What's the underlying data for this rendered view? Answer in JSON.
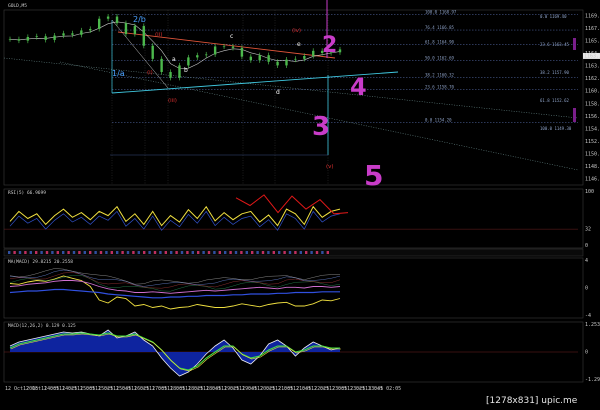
{
  "title": "GOLD,M5",
  "watermark": "[1278x831] upic.me",
  "colors": {
    "background": "#000000",
    "price": "#4cb84c",
    "ma": "#f5f5f5",
    "resistance": "#e0553a",
    "support": "#40c8e0",
    "fib": "#5a6fb0",
    "magenta": "#c83cc8",
    "rsi": "#f0e040",
    "red": "#e01818"
  },
  "chart_data": [
    {
      "type": "line",
      "name": "price",
      "x": [
        "12 Oct 2015",
        "12 Oct 14:05",
        "12 Oct 14:25",
        "12 Oct 14:45",
        "12 Oct 15:05",
        "12 Oct 15:25",
        "12 Oct 15:45",
        "12 Oct 16:05",
        "12 Oct 16:25",
        "12 Oct 16:45",
        "12 Oct 17:05",
        "12 Oct 17:25",
        "12 Oct 17:45",
        "12 Oct 18:05",
        "12 Oct 18:25",
        "12 Oct 18:45",
        "12 Oct 19:05",
        "12 Oct 19:25",
        "12 Oct 19:45",
        "12 Oct 20:05",
        "12 Oct 20:25",
        "12 Oct 20:45",
        "12 Oct 21:05",
        "12 Oct 21:25",
        "12 Oct 21:45",
        "12 Oct 22:05",
        "12 Oct 22:25",
        "12 Oct 22:45",
        "12 Oct 23:05",
        "12 Oct 23:25",
        "12 Oct 23:45",
        "13 Oct 00:05",
        "13 Oct 00:25",
        "13 Oct 00:45",
        "13 Oct 01:05",
        "13 Oct 01:25",
        "13 Oct 01:45",
        "13 Oct 02:05"
      ],
      "values": [
        1165.6,
        1165.4,
        1165.9,
        1166.0,
        1165.5,
        1166.1,
        1166.4,
        1166.2,
        1166.8,
        1167.0,
        1168.4,
        1168.7,
        1167.8,
        1166.3,
        1167.4,
        1164.7,
        1162.9,
        1161.1,
        1160.3,
        1162.0,
        1163.1,
        1163.4,
        1163.5,
        1164.6,
        1164.6,
        1164.4,
        1163.2,
        1162.7,
        1163.4,
        1162.5,
        1162.0,
        1162.8,
        1162.9,
        1163.3,
        1164.0,
        1163.7,
        1163.8,
        1164.2
      ],
      "ylim": [
        1145.6,
        1169.6
      ],
      "yticks": [
        "1169.60",
        "1167.65",
        "1165.65",
        "1164.25",
        "1163.25",
        "1162.10",
        "1160.25",
        "1158.35",
        "1156.45",
        "1154.40",
        "1152.45",
        "1150.50",
        "1148.55",
        "1146.65"
      ],
      "xticks": [
        "12 Oct 2015",
        "12 Oct 14:05",
        "12 Oct 14:25",
        "12 Oct 15:05",
        "12 Oct 15:25",
        "12 Oct 15:45",
        "12 Oct 16:25",
        "12 Oct 17:05",
        "12 Oct 18:05",
        "12 Oct 18:25",
        "12 Oct 18:45",
        "12 Oct 19:25",
        "12 Oct 19:45",
        "12 Oct 20:25",
        "12 Oct 21:05",
        "12 Oct 21:45",
        "12 Oct 22:25",
        "12 Oct 23:05",
        "12 Oct 23:25",
        "12 Oct 23:45",
        "13 Oct 02:05"
      ],
      "current_price": "1163.30",
      "fib_levels": [
        {
          "label": "100.0 1168.97",
          "y": 1168.97
        },
        {
          "label": "76.4 1166.85",
          "y": 1166.85
        },
        {
          "label": "61.8 1164.90",
          "y": 1164.9
        },
        {
          "label": "50.0 1162.69",
          "y": 1162.69
        },
        {
          "label": "38.2 1160.32",
          "y": 1160.32
        },
        {
          "label": "23.6 1158.70",
          "y": 1158.7
        },
        {
          "label": "0.0 1154.20",
          "y": 1154.2
        }
      ],
      "fib_right": [
        "0.0 1169.40",
        "23.6 1163.45",
        "38.2 1157.90",
        "61.8 1152.62",
        "100.0 1149.30"
      ],
      "wave_labels": [
        {
          "text": "2/b",
          "color": "#4aa0ff"
        },
        {
          "text": "(ii)",
          "color": "#e03030"
        },
        {
          "text": "(i)",
          "color": "#e03030"
        },
        {
          "text": "a",
          "color": "#ffffff"
        },
        {
          "text": "(iii)",
          "color": "#e03030"
        },
        {
          "text": "b",
          "color": "#ffffff"
        },
        {
          "text": "c",
          "color": "#ffffff"
        },
        {
          "text": "(iv)",
          "color": "#e03030"
        },
        {
          "text": "e",
          "color": "#ffffff"
        },
        {
          "text": "d",
          "color": "#ffffff"
        },
        {
          "text": "1/a",
          "color": "#4aa0ff"
        },
        {
          "text": "(v)",
          "color": "#e03030"
        }
      ],
      "hand_labels": [
        "2",
        "4",
        "3",
        "5"
      ]
    },
    {
      "type": "line",
      "name": "RSI(5) 66.9699",
      "title": "RSI(5) 66.9699",
      "values": [
        45,
        62,
        50,
        58,
        40,
        55,
        66,
        52,
        60,
        48,
        62,
        55,
        70,
        45,
        58,
        40,
        62,
        38,
        55,
        44,
        65,
        50,
        70,
        46,
        60,
        48,
        58,
        62,
        44,
        56,
        38,
        66,
        58,
        40,
        70,
        52,
        62,
        66
      ],
      "overlay": [
        85,
        72,
        90,
        60,
        88,
        66,
        82,
        58,
        60
      ],
      "ylim": [
        0,
        100
      ],
      "yticks": [
        "100",
        "32",
        "0"
      ]
    },
    {
      "type": "line",
      "name": "multi",
      "title": "MA(MACD) 29.8215 20.2558",
      "ylim": [
        -4,
        4
      ],
      "series": [
        {
          "values": [
            0.6,
            0.5,
            0.8,
            1.0,
            0.9,
            1.2,
            1.6,
            1.3,
            1.0,
            0.2,
            -1.6,
            -2.0,
            -1.2,
            -1.4,
            -2.4,
            -2.2,
            -2.6,
            -2.4,
            -2.8,
            -2.6,
            -2.5,
            -2.2,
            -2.4,
            -2.6,
            -2.6,
            -2.4,
            -2.1,
            -2.3,
            -2.5,
            -2.2,
            -2.0,
            -1.9,
            -2.4,
            -2.4,
            -2.1,
            -1.6,
            -1.7,
            -1.4
          ]
        },
        {
          "values": [
            0.2,
            0.3,
            0.5,
            0.6,
            0.7,
            0.9,
            1.0,
            1.0,
            0.9,
            0.6,
            0.2,
            -0.1,
            -0.3,
            -0.4,
            -0.6,
            -0.6,
            -0.5,
            -0.6,
            -0.7,
            -0.6,
            -0.5,
            -0.4,
            -0.3,
            -0.4,
            -0.3,
            -0.2,
            -0.1,
            0.0,
            0.1,
            0.0,
            -0.1,
            0.1,
            0.1,
            0.0,
            0.2,
            0.2,
            0.1,
            0.2
          ]
        },
        {
          "values": [
            -0.6,
            -0.5,
            -0.4,
            -0.4,
            -0.3,
            -0.2,
            -0.2,
            -0.3,
            -0.4,
            -0.5,
            -0.6,
            -0.8,
            -0.9,
            -1.0,
            -1.1,
            -1.2,
            -1.3,
            -1.3,
            -1.2,
            -1.2,
            -1.1,
            -1.1,
            -1.0,
            -1.0,
            -1.0,
            -0.9,
            -0.9,
            -0.8,
            -0.8,
            -0.8,
            -0.7,
            -0.7,
            -0.6,
            -0.6,
            -0.6,
            -0.5,
            -0.5,
            -0.5
          ]
        }
      ],
      "yticks": [
        "4",
        "0",
        "-4"
      ]
    },
    {
      "type": "bar",
      "name": "MACD(12,26,2) 0.129 0.125",
      "title": "MACD(12,26,2) 0.129 0.125",
      "values": [
        0.3,
        0.5,
        0.6,
        0.7,
        0.8,
        0.9,
        1.0,
        0.95,
        1.0,
        0.9,
        0.8,
        1.1,
        0.7,
        0.8,
        1.0,
        0.6,
        0.3,
        -0.3,
        -0.8,
        -1.2,
        -1.0,
        -0.6,
        -0.1,
        0.3,
        0.6,
        0.2,
        -0.4,
        -0.6,
        -0.2,
        0.4,
        0.6,
        0.3,
        -0.2,
        0.2,
        0.5,
        0.3,
        0.1,
        0.2
      ],
      "signal": [
        0.2,
        0.4,
        0.5,
        0.6,
        0.7,
        0.8,
        0.9,
        0.9,
        0.95,
        0.9,
        0.85,
        0.95,
        0.8,
        0.8,
        0.9,
        0.7,
        0.5,
        0.1,
        -0.4,
        -0.8,
        -0.9,
        -0.7,
        -0.3,
        0.0,
        0.3,
        0.3,
        -0.1,
        -0.3,
        -0.2,
        0.1,
        0.3,
        0.3,
        0.0,
        0.1,
        0.3,
        0.3,
        0.2,
        0.2
      ],
      "ylim": [
        -1.5,
        1.5
      ],
      "yticks": [
        "1.253",
        "0",
        "-1.292"
      ]
    }
  ]
}
